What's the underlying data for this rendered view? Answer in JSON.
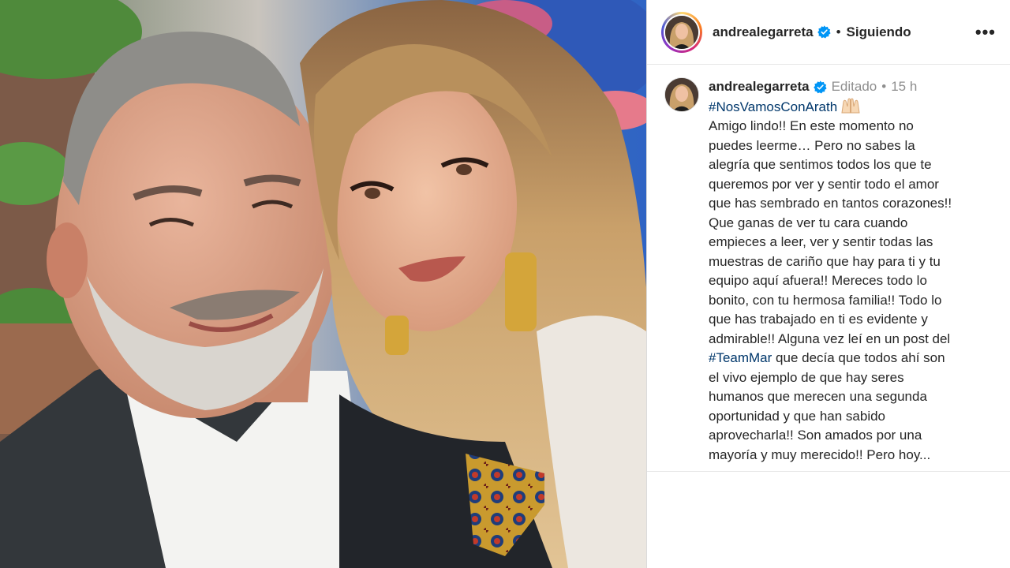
{
  "post": {
    "username": "andrealegarreta",
    "follow_status": "Siguiendo",
    "more_label": "•••",
    "edited_label": "Editado",
    "time_ago": "15 h",
    "separator": "•"
  },
  "caption": {
    "hashtag_1": "#NosVamosConArath",
    "emoji": "raising-hands",
    "text_1": "Amigo lindo!! En este momento no\npuedes leerme… Pero no sabes la\nalegría que sentimos todos los que te\nqueremos por ver y sentir todo el amor\nque has sembrado en tantos corazones!!\nQue ganas de ver tu cara cuando\nempieces a leer, ver y sentir todas las\nmuestras de cariño que hay para ti y tu\nequipo aquí afuera!! Mereces todo lo\nbonito, con tu hermosa familia!! Todo lo\nque has trabajado en ti es evidente y\nadmirable!! Alguna vez leí en un post del",
    "hashtag_2": "#TeamMar",
    "text_2": " que decía que todos ahí son\nel vivo ejemplo de que hay seres\nhumanos que merecen una segunda\noportunidad y que han sabido\naprovecharla!! Son amados por una\nmayoría y muy merecido!! Pero hoy..."
  },
  "colors": {
    "hashtag": "#00376b",
    "verified": "#0095f6",
    "meta": "#8e8e8e",
    "text": "#262626"
  },
  "icons": {
    "verified": "verified-badge-icon",
    "more": "more-options-icon"
  }
}
